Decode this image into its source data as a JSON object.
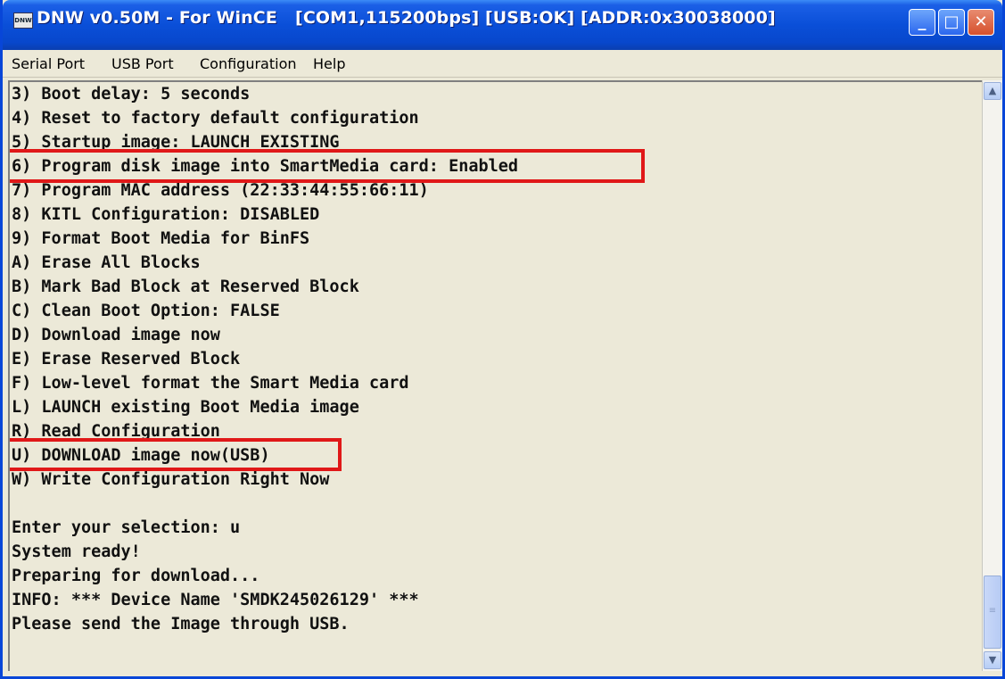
{
  "window": {
    "icon_text": "DNW",
    "title": "DNW v0.50M - For WinCE   [COM1,115200bps] [USB:OK] [ADDR:0x30038000]",
    "controls": {
      "minimize": "_",
      "maximize": "□",
      "close": "✕"
    }
  },
  "menu": {
    "items": [
      "Serial Port",
      "USB Port",
      "Configuration",
      "Help"
    ]
  },
  "console": {
    "lines": [
      "3) Boot delay: 5 seconds",
      "4) Reset to factory default configuration",
      "5) Startup image: LAUNCH EXISTING",
      "6) Program disk image into SmartMedia card: Enabled",
      "7) Program MAC address (22:33:44:55:66:11)",
      "8) KITL Configuration: DISABLED",
      "9) Format Boot Media for BinFS",
      "A) Erase All Blocks",
      "B) Mark Bad Block at Reserved Block",
      "C) Clean Boot Option: FALSE",
      "D) Download image now",
      "E) Erase Reserved Block",
      "F) Low-level format the Smart Media card",
      "L) LAUNCH existing Boot Media image",
      "R) Read Configuration",
      "U) DOWNLOAD image now(USB)",
      "W) Write Configuration Right Now",
      "",
      "Enter your selection: u",
      "System ready!",
      "Preparing for download...",
      "INFO: *** Device Name 'SMDK245026129' ***",
      "Please send the Image through USB."
    ]
  },
  "scrollbar": {
    "up": "▲",
    "down": "▼",
    "grip": "≡"
  },
  "colors": {
    "title_bar": "#0a4fd8",
    "highlight_box": "#e01818",
    "console_background": "#ece9d8"
  }
}
